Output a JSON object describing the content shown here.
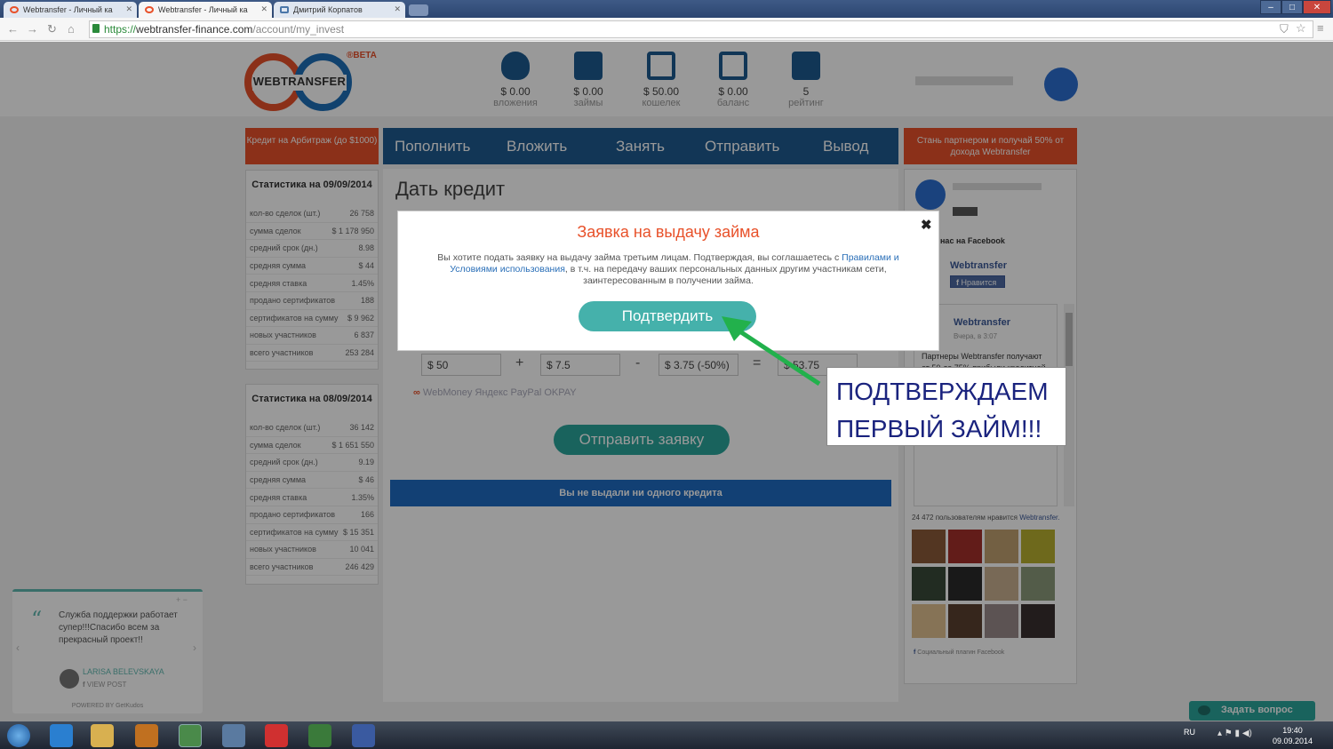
{
  "browser": {
    "tabs": [
      {
        "label": "Webtransfer - Личный ка"
      },
      {
        "label": "Webtransfer - Личный ка"
      },
      {
        "label": "Дмитрий Корпатов"
      }
    ],
    "url_scheme": "https://",
    "url_host": "webtransfer-finance.com",
    "url_path": "/account/my_invest"
  },
  "site": {
    "logo_text": "WEBTRANSFER",
    "beta": "®BETA",
    "stats": [
      {
        "value": "$ 0.00",
        "label": "вложения",
        "icon": "piggy-bank-icon"
      },
      {
        "value": "$ 0.00",
        "label": "займы",
        "icon": "coins-icon"
      },
      {
        "value": "$ 50.00",
        "label": "кошелек",
        "icon": "safe-icon"
      },
      {
        "value": "$ 0.00",
        "label": "баланс",
        "icon": "abacus-icon"
      },
      {
        "value": "5",
        "label": "рейтинг",
        "icon": "rating-chart-icon"
      }
    ],
    "promo_left": "Кредит на Арбитраж (до $1000)",
    "promo_right": "Стань партнером и получай 50% от дохода Webtransfer",
    "menu": [
      "Пополнить",
      "Вложить",
      "Занять",
      "Отправить",
      "Вывод"
    ]
  },
  "stats_today": {
    "title": "Статистика на 09/09/2014",
    "rows": [
      {
        "k": "кол-во сделок (шт.)",
        "v": "26 758"
      },
      {
        "k": "сумма сделок",
        "v": "$ 1 178 950"
      },
      {
        "k": "средний срок (дн.)",
        "v": "8.98"
      },
      {
        "k": "средняя сумма",
        "v": "$ 44"
      },
      {
        "k": "средняя ставка",
        "v": "1.45%"
      },
      {
        "k": "продано сертификатов",
        "v": "188"
      },
      {
        "k": "сертификатов на сумму",
        "v": "$ 9 962"
      },
      {
        "k": "новых участников",
        "v": "6 837"
      },
      {
        "k": "всего участников",
        "v": "253 284"
      }
    ]
  },
  "stats_yesterday": {
    "title": "Статистика на 08/09/2014",
    "rows": [
      {
        "k": "кол-во сделок (шт.)",
        "v": "36 142"
      },
      {
        "k": "сумма сделок",
        "v": "$ 1 651 550"
      },
      {
        "k": "средний срок (дн.)",
        "v": "9.19"
      },
      {
        "k": "средняя сумма",
        "v": "$ 46"
      },
      {
        "k": "средняя ставка",
        "v": "1.35%"
      },
      {
        "k": "продано сертификатов",
        "v": "166"
      },
      {
        "k": "сертификатов на сумму",
        "v": "$ 15 351"
      },
      {
        "k": "новых участников",
        "v": "10 041"
      },
      {
        "k": "всего участников",
        "v": "246 429"
      }
    ]
  },
  "main": {
    "title": "Дать кредит",
    "fields": [
      "$ 50",
      "$ 7.5",
      "$ 3.75 (-50%)",
      "$ 53.75"
    ],
    "ops": [
      "+",
      "-",
      "="
    ],
    "payments": "WebMoney   Яндекс   PayPal   OKPAY",
    "send_button": "Отправить заявку",
    "no_credits": "Вы не выдали ни одного кредита"
  },
  "modal": {
    "title": "Заявка на выдачу займа",
    "text_before": "Вы хотите подать заявку на выдачу займа третьим лицам. Подтверждая, вы соглашаетесь с ",
    "link": "Правилами и Условиями использования",
    "text_after": ", в т.ч. на передачу ваших персональных данных другим участникам сети, заинтересованным в получении займа.",
    "confirm": "Подтвердить",
    "close": "✖"
  },
  "annotation": {
    "line1": "ПОДТВЕРЖДАЕМ",
    "line2": "ПЕРВЫЙ ЗАЙМ!!!"
  },
  "facebook": {
    "header": "нас на Facebook",
    "page_name": "Webtransfer",
    "like": "Нравится",
    "post_author": "Webtransfer",
    "post_time": "Вчера, в 3:07",
    "post_text": "Партнеры Webtransfer получают от 50 до 75% прибыли кредитной сети... гарантируется возврат основной суммы плюс минимальный процент), отчисляют в Webtransfer от 30 до 50% своей фактически",
    "likes_count_text": "24 472 пользователям нравится",
    "likes_link": "Webtransfer.",
    "plugin": "Социальный плагин Facebook"
  },
  "review": {
    "text": "Служба поддержки работает супер!!!Спасибо всем за прекрасный проект!!",
    "name": "LARISA BELEVSKAYA",
    "view": "VIEW POST",
    "powered": "POWERED BY  GetKudos"
  },
  "ask_button": "Задать вопрос",
  "taskbar": {
    "lang": "RU",
    "time": "19:40",
    "date": "09.09.2014"
  },
  "colors": {
    "accent_orange": "#e8512a",
    "brand_blue": "#1e5a8f",
    "teal": "#2aa59b",
    "callout_text": "#1a237e",
    "arrow": "#22b14c"
  }
}
